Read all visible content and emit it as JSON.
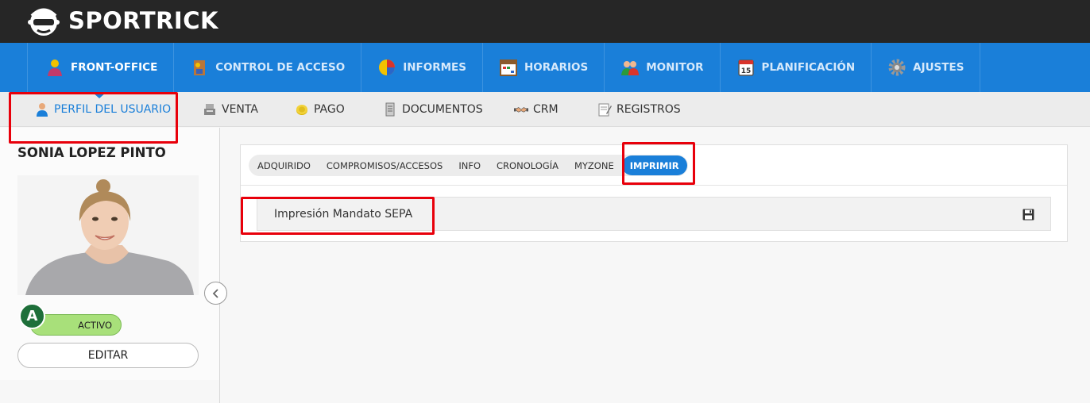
{
  "app": {
    "brand": "SPORTRICK"
  },
  "main_nav": [
    {
      "label": "FRONT-OFFICE",
      "icon": "user-icon",
      "active": true
    },
    {
      "label": "CONTROL DE ACCESO",
      "icon": "access-control-icon"
    },
    {
      "label": "INFORMES",
      "icon": "pie-chart-icon"
    },
    {
      "label": "HORARIOS",
      "icon": "calendar-grid-icon"
    },
    {
      "label": "MONITOR",
      "icon": "users-icon"
    },
    {
      "label": "PLANIFICACIÓN",
      "icon": "calendar-icon"
    },
    {
      "label": "AJUSTES",
      "icon": "gear-icon"
    }
  ],
  "sub_nav": [
    {
      "label": "PERFIL DEL USUARIO",
      "icon": "user-profile-icon",
      "active": true
    },
    {
      "label": "VENTA",
      "icon": "cash-register-icon"
    },
    {
      "label": "PAGO",
      "icon": "coin-icon"
    },
    {
      "label": "DOCUMENTOS",
      "icon": "document-icon"
    },
    {
      "label": "CRM",
      "icon": "handshake-icon"
    },
    {
      "label": "REGISTROS",
      "icon": "notepad-icon"
    }
  ],
  "user": {
    "name": "SONIA LOPEZ PINTO",
    "status_badge": "A",
    "status_label": "ACTIVO",
    "edit_label": "EDITAR"
  },
  "tabs": [
    {
      "label": "ADQUIRIDO"
    },
    {
      "label": "COMPROMISOS/ACCESOS"
    },
    {
      "label": "INFO"
    },
    {
      "label": "CRONOLOGÍA"
    },
    {
      "label": "MYZONE"
    },
    {
      "label": "IMPRIMIR",
      "active": true
    }
  ],
  "print": {
    "document_label": "Impresión Mandato SEPA",
    "save_icon": "save-icon"
  },
  "colors": {
    "accent": "#1a7fd9",
    "topbar": "#262626",
    "status_green": "#a8e07a",
    "highlight": "#e8000b"
  }
}
